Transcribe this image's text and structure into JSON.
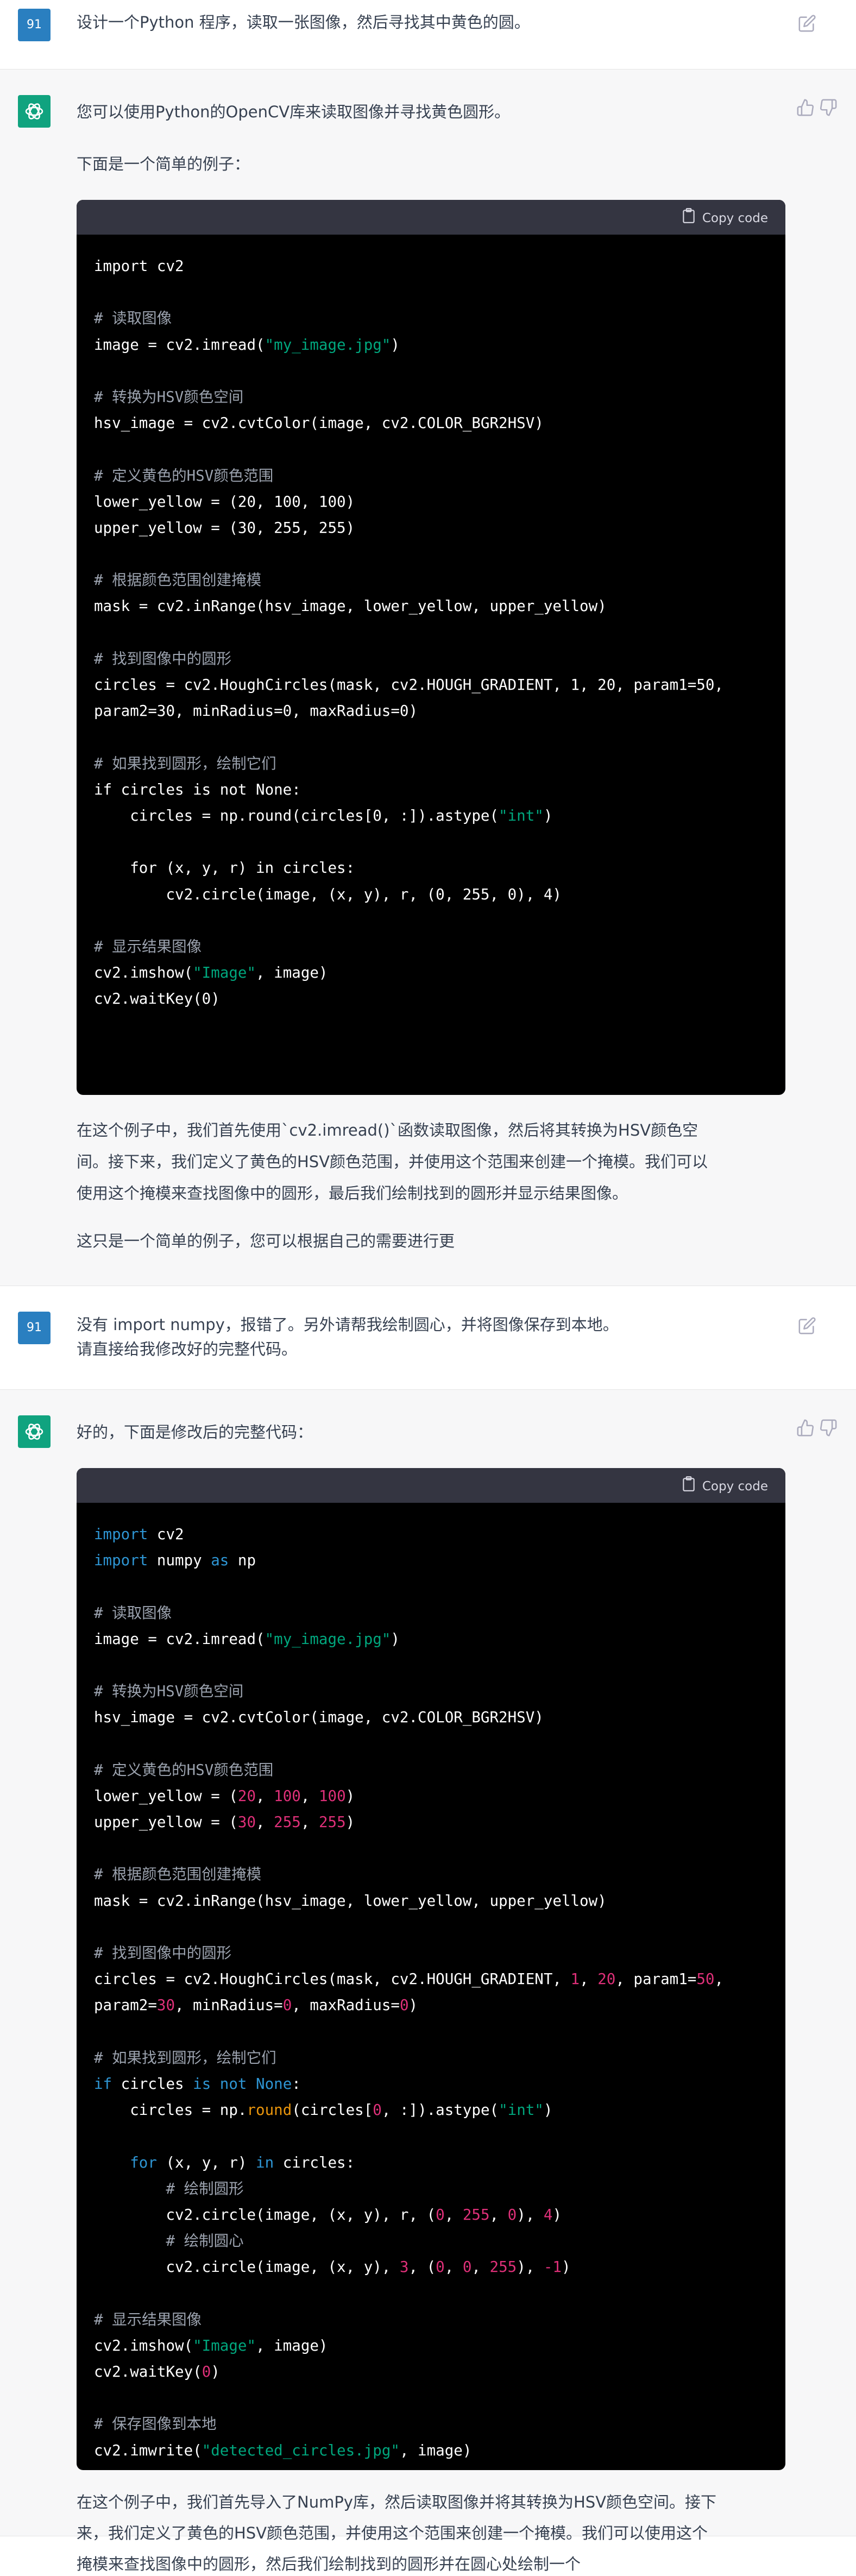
{
  "turns": [
    {
      "role": "user",
      "avatar": "91",
      "text": "设计一个Python 程序，读取一张图像，然后寻找其中黄色的圆。"
    },
    {
      "role": "assistant",
      "intro": "您可以使用Python的OpenCV库来读取图像并寻找黄色圆形。",
      "lead": "下面是一个简单的例子：",
      "copy_label": "Copy code",
      "code": [
        "import cv2",
        "",
        "# 读取图像",
        "image = cv2.imread(\"my_image.jpg\")",
        "",
        "# 转换为HSV颜色空间",
        "hsv_image = cv2.cvtColor(image, cv2.COLOR_BGR2HSV)",
        "",
        "# 定义黄色的HSV颜色范围",
        "lower_yellow = (20, 100, 100)",
        "upper_yellow = (30, 255, 255)",
        "",
        "# 根据颜色范围创建掩模",
        "mask = cv2.inRange(hsv_image, lower_yellow, upper_yellow)",
        "",
        "# 找到图像中的圆形",
        "circles = cv2.HoughCircles(mask, cv2.HOUGH_GRADIENT, 1, 20, param1=50,",
        "param2=30, minRadius=0, maxRadius=0)",
        "",
        "# 如果找到圆形，绘制它们",
        "if circles is not None:",
        "    circles = np.round(circles[0, :]).astype(\"int\")",
        "",
        "    for (x, y, r) in circles:",
        "        cv2.circle(image, (x, y), r, (0, 255, 0), 4)",
        "",
        "# 显示结果图像",
        "cv2.imshow(\"Image\", image)",
        "cv2.waitKey(0)"
      ],
      "para1_line1": "在这个例子中，我们首先使用`cv2.imread()`函数读取图像，然后将其转换为HSV颜色空",
      "para1_line2": "间。接下来，我们定义了黄色的HSV颜色范围，并使用这个范围来创建一个掩模。我们可以",
      "para1_line3": "使用这个掩模来查找图像中的圆形，最后我们绘制找到的圆形并显示结果图像。",
      "para2": "这只是一个简单的例子，您可以根据自己的需要进行更"
    },
    {
      "role": "user",
      "avatar": "91",
      "line1": "没有 import numpy，报错了。另外请帮我绘制圆心，并将图像保存到本地。",
      "line2": "请直接给我修改好的完整代码。"
    },
    {
      "role": "assistant",
      "intro": "好的，下面是修改后的完整代码：",
      "copy_label": "Copy code",
      "outro_line1": "在这个例子中，我们首先导入了NumPy库，然后读取图像并将其转换为HSV颜色空间。接下",
      "outro_line2": "来，我们定义了黄色的HSV颜色范围，并使用这个范围来创建一个掩模。我们可以使用这个",
      "outro_line3": "掩模来查找图像中的圆形，然后我们绘制找到的圆形并在圆心处绘制一个"
    }
  ],
  "code2": [
    [
      [
        "kw",
        "import"
      ],
      [
        "t",
        " cv2"
      ]
    ],
    [
      [
        "kw",
        "import"
      ],
      [
        "t",
        " numpy "
      ],
      [
        "kw",
        "as"
      ],
      [
        "t",
        " np"
      ]
    ],
    [],
    [
      [
        "cm",
        "# 读取图像"
      ]
    ],
    [
      [
        "t",
        "image = cv2.imread("
      ],
      [
        "st",
        "\"my_image.jpg\""
      ],
      [
        "t",
        ")"
      ]
    ],
    [],
    [
      [
        "cm",
        "# 转换为HSV颜色空间"
      ]
    ],
    [
      [
        "t",
        "hsv_image = cv2.cvtColor(image, cv2.COLOR_BGR2HSV)"
      ]
    ],
    [],
    [
      [
        "cm",
        "# 定义黄色的HSV颜色范围"
      ]
    ],
    [
      [
        "t",
        "lower_yellow = ("
      ],
      [
        "nm",
        "20"
      ],
      [
        "t",
        ", "
      ],
      [
        "nm",
        "100"
      ],
      [
        "t",
        ", "
      ],
      [
        "nm",
        "100"
      ],
      [
        "t",
        ")"
      ]
    ],
    [
      [
        "t",
        "upper_yellow = ("
      ],
      [
        "nm",
        "30"
      ],
      [
        "t",
        ", "
      ],
      [
        "nm",
        "255"
      ],
      [
        "t",
        ", "
      ],
      [
        "nm",
        "255"
      ],
      [
        "t",
        ")"
      ]
    ],
    [],
    [
      [
        "cm",
        "# 根据颜色范围创建掩模"
      ]
    ],
    [
      [
        "t",
        "mask = cv2.inRange(hsv_image, lower_yellow, upper_yellow)"
      ]
    ],
    [],
    [
      [
        "cm",
        "# 找到图像中的圆形"
      ]
    ],
    [
      [
        "t",
        "circles = cv2.HoughCircles(mask, cv2.HOUGH_GRADIENT, "
      ],
      [
        "nm",
        "1"
      ],
      [
        "t",
        ", "
      ],
      [
        "nm",
        "20"
      ],
      [
        "t",
        ", param1="
      ],
      [
        "nm",
        "50"
      ],
      [
        "t",
        ","
      ]
    ],
    [
      [
        "t",
        "param2="
      ],
      [
        "nm",
        "30"
      ],
      [
        "t",
        ", minRadius="
      ],
      [
        "nm",
        "0"
      ],
      [
        "t",
        ", maxRadius="
      ],
      [
        "nm",
        "0"
      ],
      [
        "t",
        ")"
      ]
    ],
    [],
    [
      [
        "cm",
        "# 如果找到圆形，绘制它们"
      ]
    ],
    [
      [
        "kw",
        "if"
      ],
      [
        "t",
        " circles "
      ],
      [
        "kw",
        "is not"
      ],
      [
        "t",
        " "
      ],
      [
        "kw",
        "None"
      ],
      [
        "t",
        ":"
      ]
    ],
    [
      [
        "t",
        "    circles = np."
      ],
      [
        "bi",
        "round"
      ],
      [
        "t",
        "(circles["
      ],
      [
        "nm",
        "0"
      ],
      [
        "t",
        ", :]).astype("
      ],
      [
        "st",
        "\"int\""
      ],
      [
        "t",
        ")"
      ]
    ],
    [],
    [
      [
        "t",
        "    "
      ],
      [
        "kw",
        "for"
      ],
      [
        "t",
        " (x, y, r) "
      ],
      [
        "kw",
        "in"
      ],
      [
        "t",
        " circles:"
      ]
    ],
    [
      [
        "t",
        "        "
      ],
      [
        "cm",
        "# 绘制圆形"
      ]
    ],
    [
      [
        "t",
        "        cv2.circle(image, (x, y), r, ("
      ],
      [
        "nm",
        "0"
      ],
      [
        "t",
        ", "
      ],
      [
        "nm",
        "255"
      ],
      [
        "t",
        ", "
      ],
      [
        "nm",
        "0"
      ],
      [
        "t",
        "), "
      ],
      [
        "nm",
        "4"
      ],
      [
        "t",
        ")"
      ]
    ],
    [
      [
        "t",
        "        "
      ],
      [
        "cm",
        "# 绘制圆心"
      ]
    ],
    [
      [
        "t",
        "        cv2.circle(image, (x, y), "
      ],
      [
        "nm",
        "3"
      ],
      [
        "t",
        ", ("
      ],
      [
        "nm",
        "0"
      ],
      [
        "t",
        ", "
      ],
      [
        "nm",
        "0"
      ],
      [
        "t",
        ", "
      ],
      [
        "nm",
        "255"
      ],
      [
        "t",
        "), "
      ],
      [
        "nm",
        "-1"
      ],
      [
        "t",
        ")"
      ]
    ],
    [],
    [
      [
        "cm",
        "# 显示结果图像"
      ]
    ],
    [
      [
        "t",
        "cv2.imshow("
      ],
      [
        "st",
        "\"Image\""
      ],
      [
        "t",
        ", image)"
      ]
    ],
    [
      [
        "t",
        "cv2.waitKey("
      ],
      [
        "nm",
        "0"
      ],
      [
        "t",
        ")"
      ]
    ],
    [],
    [
      [
        "cm",
        "# 保存图像到本地"
      ]
    ],
    [
      [
        "t",
        "cv2.imwrite("
      ],
      [
        "st",
        "\"detected_circles.jpg\""
      ],
      [
        "t",
        ", image)"
      ]
    ]
  ]
}
